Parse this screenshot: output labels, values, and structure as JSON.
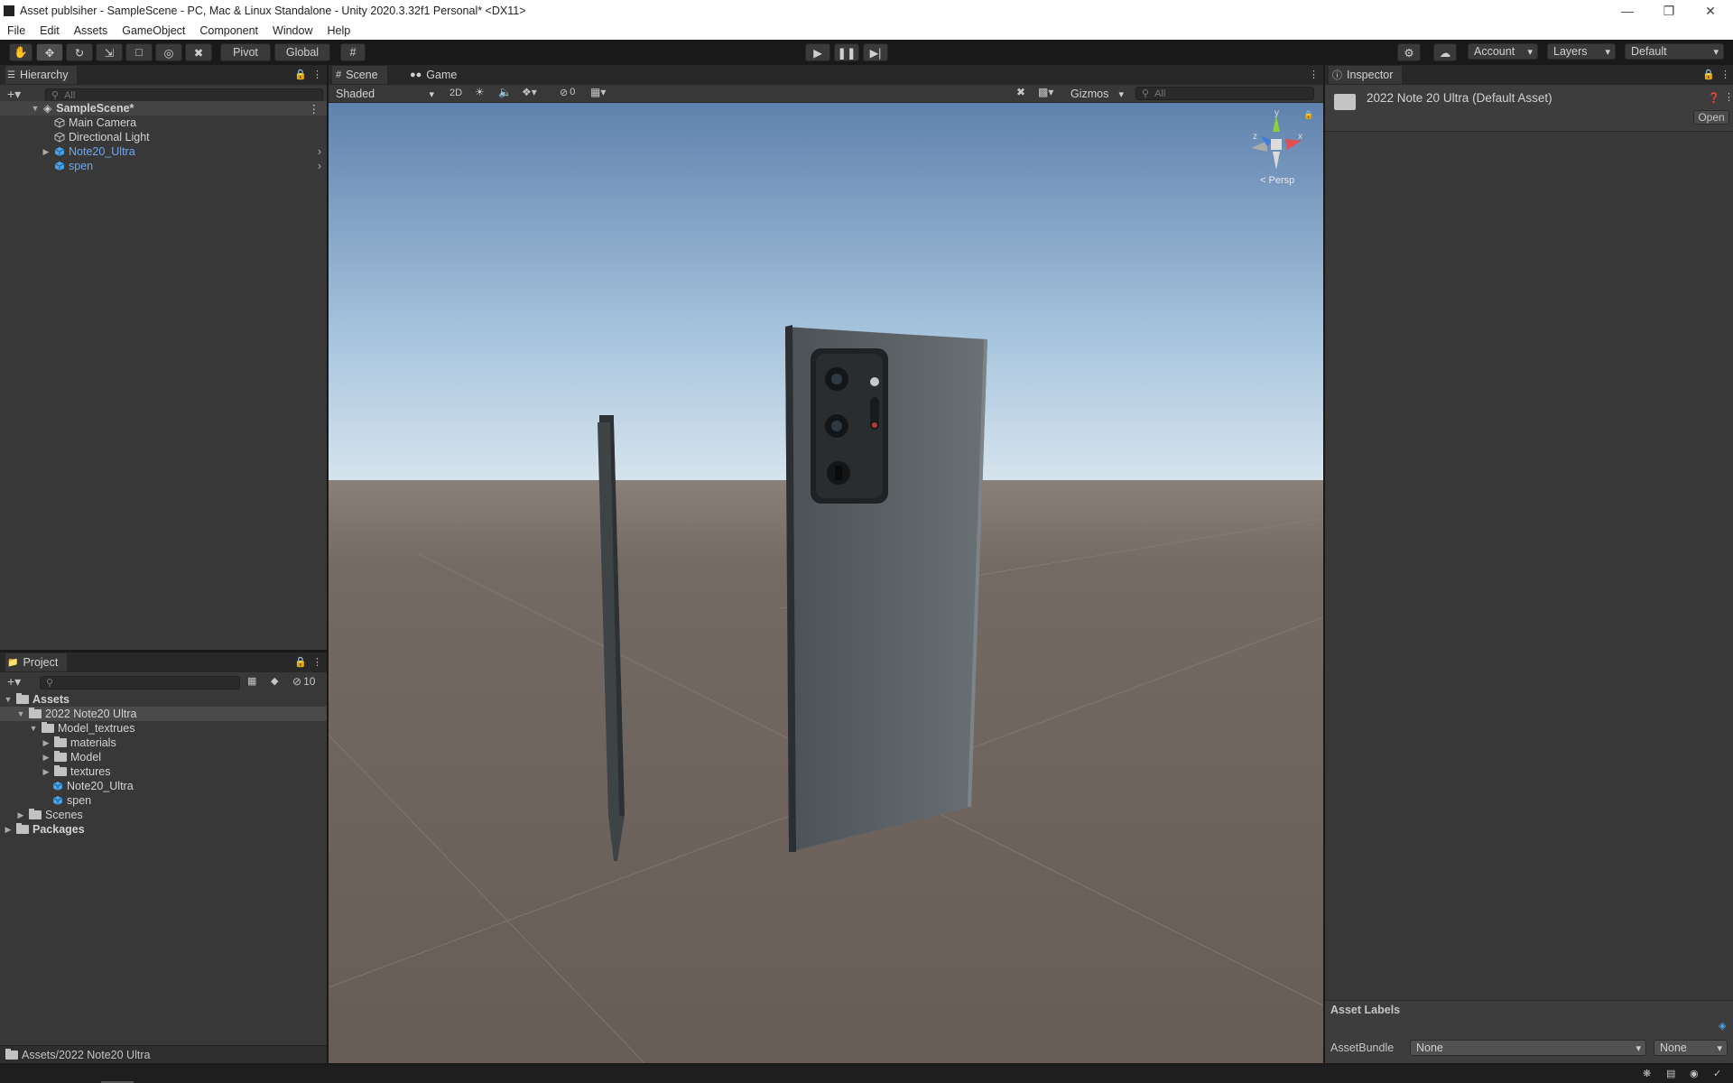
{
  "window": {
    "title": "Asset publsiher - SampleScene - PC, Mac & Linux Standalone - Unity 2020.3.32f1 Personal* <DX11>"
  },
  "menu": [
    "File",
    "Edit",
    "Assets",
    "GameObject",
    "Component",
    "Window",
    "Help"
  ],
  "toolbar": {
    "pivot": "Pivot",
    "global": "Global",
    "account": "Account",
    "layers": "Layers",
    "layout": "Default"
  },
  "hierarchy": {
    "title": "Hierarchy",
    "search_placeholder": "All",
    "scene": "SampleScene*",
    "items": [
      "Main Camera",
      "Directional Light",
      "Note20_Ultra",
      "spen"
    ]
  },
  "scene_view": {
    "tab_scene": "Scene",
    "tab_game": "Game",
    "shading": "Shaded",
    "mode_2d": "2D",
    "hidden_count": "0",
    "gizmos": "Gizmos",
    "search_placeholder": "All",
    "persp": "Persp",
    "axis_y": "y",
    "axis_z": "z",
    "axis_x": "x"
  },
  "inspector": {
    "title": "Inspector",
    "asset_name": "2022 Note 20 Ultra (Default Asset)",
    "open_label": "Open",
    "asset_labels": "Asset Labels",
    "assetbundle_label": "AssetBundle",
    "bundle_value": "None",
    "variant_value": "None"
  },
  "project": {
    "title": "Project",
    "hidden_count": "10",
    "tree": {
      "assets": "Assets",
      "note_folder": "2022 Note20 Ultra",
      "model_textures": "Model_textrues",
      "materials": "materials",
      "model": "Model",
      "textures": "textures",
      "note_prefab": "Note20_Ultra",
      "spen_prefab": "spen",
      "scenes": "Scenes",
      "packages": "Packages"
    },
    "path": "Assets/2022 Note20 Ultra"
  },
  "colors": {
    "selection": "#2c5d87",
    "prefab_text": "#6ea8f0",
    "panel": "#383838",
    "tabbar": "#282828"
  }
}
